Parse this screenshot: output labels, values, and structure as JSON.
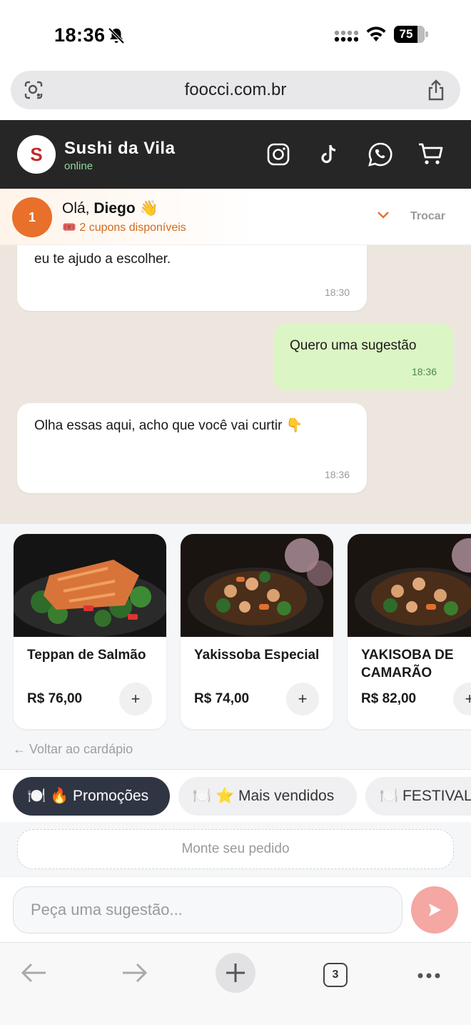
{
  "status_bar": {
    "time": "18:36",
    "battery": "75"
  },
  "browser": {
    "url": "foocci.com.br",
    "tab_count": "3"
  },
  "header": {
    "logo_letter": "S",
    "shop_name": "Sushi da Vila",
    "status": "online",
    "icons": [
      "instagram-icon",
      "tiktok-icon",
      "whatsapp-icon",
      "cart-icon"
    ]
  },
  "greeting": {
    "avatar_label": "1",
    "hello": "Olá,",
    "name": "Diego",
    "wave_emoji": "👋",
    "coupons": "🎟️ 2 cupons disponíveis",
    "switch_label": "Trocar"
  },
  "chat": {
    "messages": [
      {
        "from": "bot",
        "text": "Fica à vontade pra olhar o cardápio. Se quiser, eu te ajudo a escolher.",
        "time": "18:30"
      },
      {
        "from": "user",
        "text": "Quero uma sugestão",
        "time": "18:36"
      },
      {
        "from": "bot",
        "text": "Olha essas aqui, acho que você vai curtir 👇",
        "time": "18:36"
      }
    ]
  },
  "products": [
    {
      "name": "Teppan de Salmão",
      "price": "R$ 76,00",
      "add_label": "+"
    },
    {
      "name": "Yakissoba Especial",
      "price": "R$ 74,00",
      "add_label": "+"
    },
    {
      "name": "YAKISOBA DE CAMARÃO",
      "price": "R$ 82,00",
      "add_label": "+"
    }
  ],
  "back_link": "← Voltar ao cardápio",
  "categories": [
    {
      "label": "🍽️ 🔥 Promoções",
      "active": true
    },
    {
      "label": "🍽️ ⭐ Mais vendidos",
      "active": false
    },
    {
      "label": "🍽️ FESTIVAL",
      "active": false
    }
  ],
  "build_order_label": "Monte seu pedido",
  "input": {
    "placeholder": "Peça uma sugestão..."
  },
  "colors": {
    "accent": "#e8702a",
    "header_bg": "#262626",
    "send": "#f4a7a3",
    "user_bubble": "#dcf5c4",
    "chat_bg": "#ede6df"
  }
}
